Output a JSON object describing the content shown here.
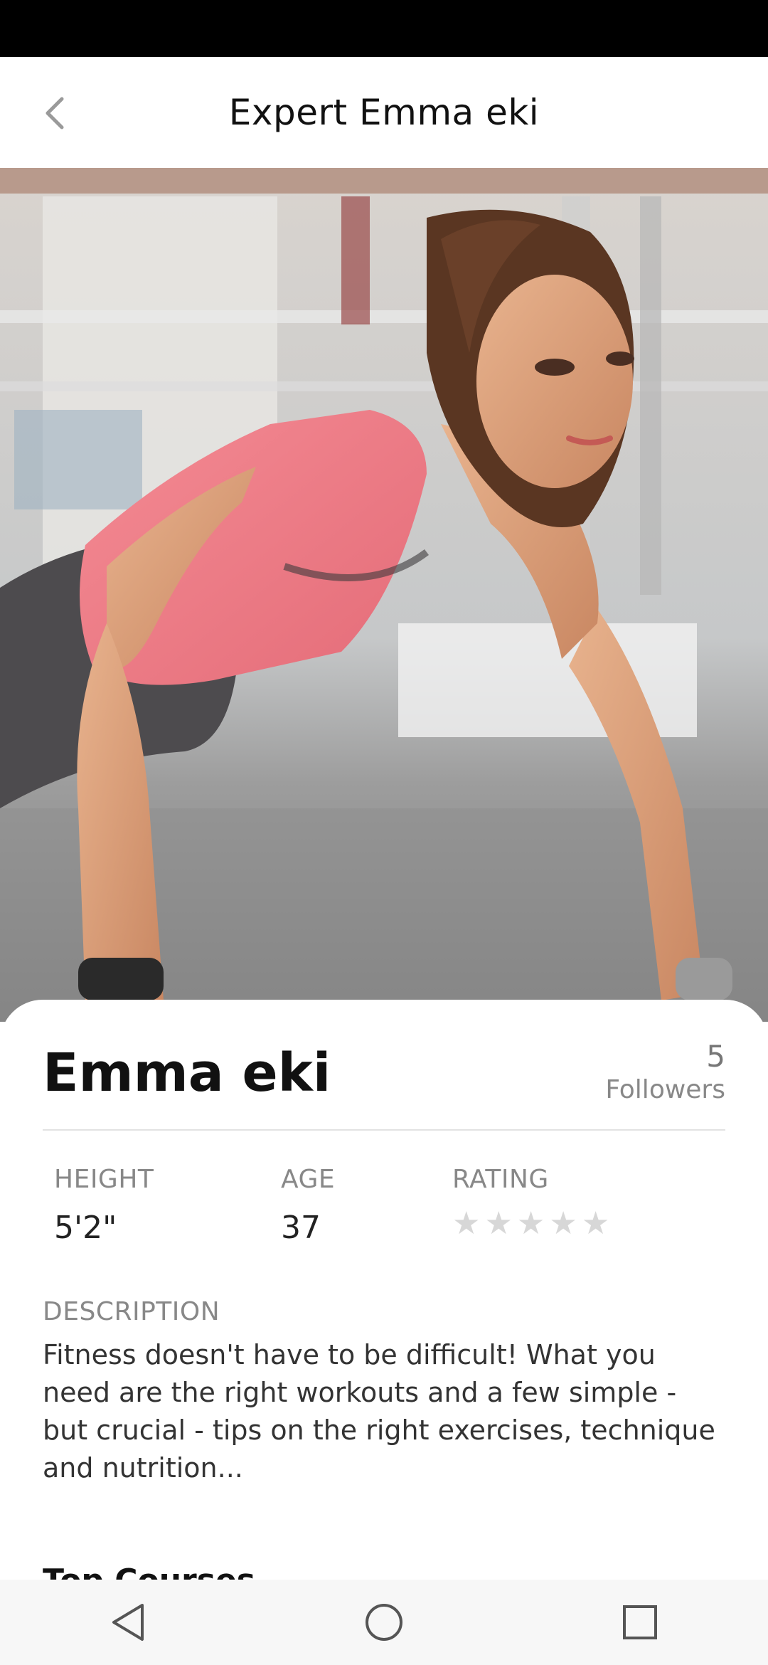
{
  "app_bar": {
    "title": "Expert Emma eki",
    "back_icon": "chevron-left-icon"
  },
  "hero": {
    "image": "trainer-photo-pushup"
  },
  "profile": {
    "name": "Emma eki",
    "followers_count": "5",
    "followers_label": "Followers",
    "stats": {
      "height_label": "HEIGHT",
      "height_value": "5'2\"",
      "age_label": "AGE",
      "age_value": "37",
      "rating_label": "RATING",
      "rating_stars_filled": 0,
      "rating_stars_total": 5
    },
    "description_label": "DESCRIPTION",
    "description": "Fitness doesn't have to be difficult! What you need are the right workouts and a few simple - but crucial - tips on the right exercises, technique and nutrition...",
    "section_title": "Top Courses"
  },
  "nav": {
    "back_icon": "triangle-back-icon",
    "home_icon": "circle-home-icon",
    "recents_icon": "square-recents-icon"
  },
  "colors": {
    "accent_pink": "#f07d88",
    "text_dark": "#111111",
    "text_muted": "#888888",
    "star_empty": "#d7d7d7"
  }
}
